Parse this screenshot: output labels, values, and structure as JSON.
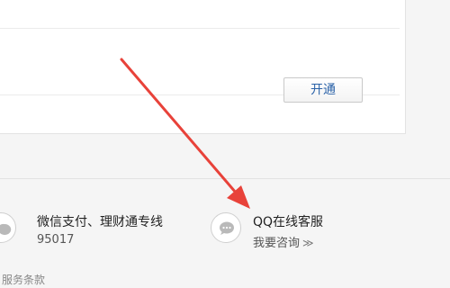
{
  "panel": {
    "rows": [
      {
        "button_label": "开通"
      },
      {
        "button_label": "开通"
      }
    ]
  },
  "services": [
    {
      "title": "微信支付、理财通专线",
      "subtitle": "95017",
      "icon": "wechat-chat-icon"
    },
    {
      "title": "QQ在线客服",
      "subtitle": "我要咨询",
      "subtitle_suffix": "≫",
      "icon": "qq-chat-icon"
    }
  ],
  "footer": {
    "terms_link": "服务条款"
  },
  "annotation": {
    "arrow_color": "#e8423a"
  }
}
